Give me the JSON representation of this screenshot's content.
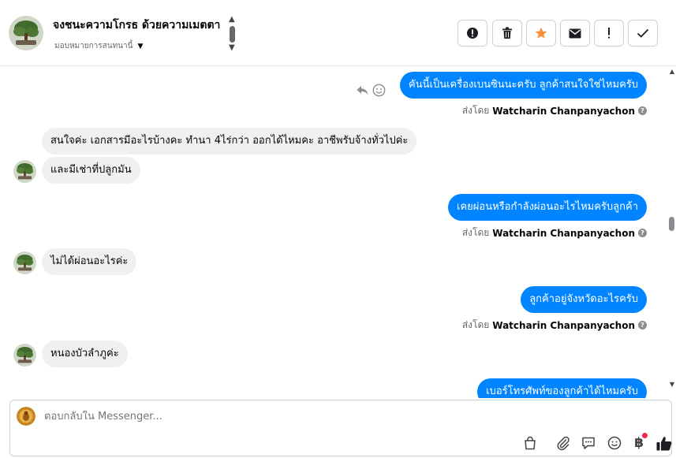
{
  "header": {
    "title": "จงชนะความโกรธ ด้วยความเมตตา",
    "assign_label": "มอบหมายการสนทนานี้"
  },
  "actions": {
    "alert_icon": "alert-circle-icon",
    "trash_icon": "trash-icon",
    "star_icon": "star-icon",
    "mail_icon": "envelope-icon",
    "important_icon": "exclamation-icon",
    "done_icon": "check-icon",
    "star_color": "#f7923a"
  },
  "thread": {
    "messages": [
      {
        "direction": "out",
        "text": "คันนี้เป็นเครื่องเบนซินนะครับ ลูกค้าสนใจใช่ไหมครับ",
        "sent_by_prefix": "ส่งโดย",
        "sent_by_name": "Watcharin Chanpanyachon"
      },
      {
        "direction": "in",
        "text": "สนใจค่ะ เอกสารมีอะไรบ้างคะ ทำนา 4ไร่กว่า ออกได้ไหมคะ อาชีพรับจ้างทั่วไปค่ะ"
      },
      {
        "direction": "in",
        "text": "และมีเช่าที่ปลูกมัน"
      },
      {
        "direction": "out",
        "text": "เคยผ่อนหรือกำลังผ่อนอะไรไหมครับลูกค้า",
        "sent_by_prefix": "ส่งโดย",
        "sent_by_name": "Watcharin Chanpanyachon"
      },
      {
        "direction": "in",
        "text": "ไม่ได้ผ่อนอะไรค่ะ"
      },
      {
        "direction": "out",
        "text": "ลูกค้าอยู่จังหวัดอะไรครับ",
        "sent_by_prefix": "ส่งโดย",
        "sent_by_name": "Watcharin Chanpanyachon"
      },
      {
        "direction": "in",
        "text": "หนองบัวลำภูค่ะ"
      },
      {
        "direction": "out",
        "text": "เบอร์โทรศัพท์ของลูกค้าได้ไหมครับ"
      }
    ]
  },
  "composer": {
    "placeholder": "ตอบกลับใน Messenger..."
  },
  "colors": {
    "outgoing_bubble": "#0084ff",
    "incoming_bubble": "#f0f0f0",
    "like_icon": "#1c1e21",
    "notification_dot": "#f02849"
  }
}
